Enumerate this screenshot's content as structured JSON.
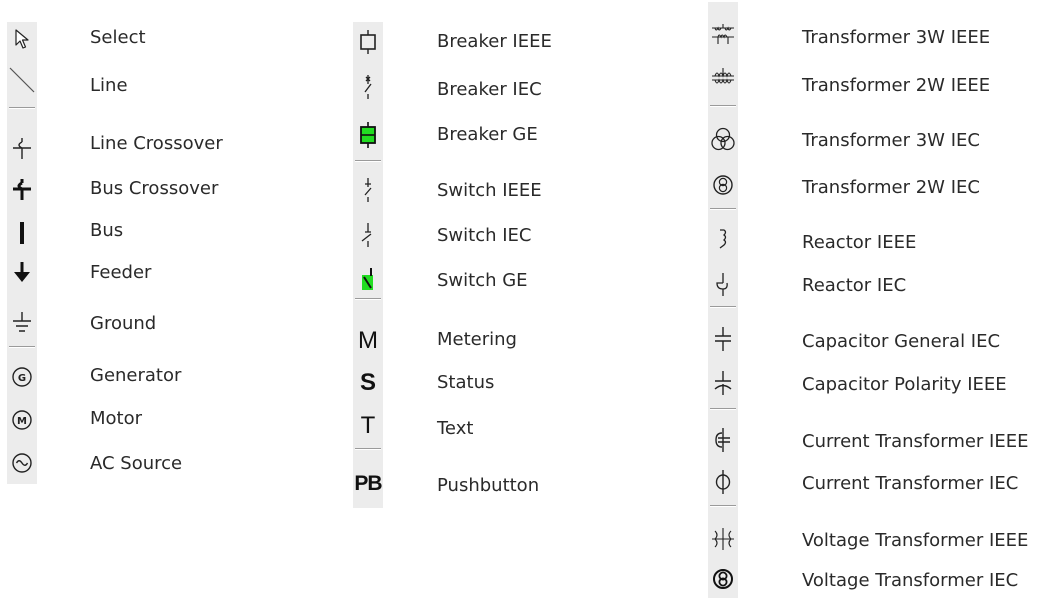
{
  "columns": [
    {
      "tools": [
        {
          "icon": "select-arrow-icon",
          "label": "Select"
        },
        {
          "icon": "line-icon",
          "label": "Line"
        },
        {
          "icon": "line-crossover-icon",
          "label": "Line Crossover"
        },
        {
          "icon": "bus-crossover-icon",
          "label": "Bus Crossover"
        },
        {
          "icon": "bus-icon",
          "label": "Bus"
        },
        {
          "icon": "feeder-icon",
          "label": "Feeder"
        },
        {
          "icon": "ground-icon",
          "label": "Ground"
        },
        {
          "icon": "generator-icon",
          "label": "Generator",
          "glyph": "G"
        },
        {
          "icon": "motor-icon",
          "label": "Motor",
          "glyph": "M"
        },
        {
          "icon": "ac-source-icon",
          "label": "AC Source"
        }
      ]
    },
    {
      "tools": [
        {
          "icon": "breaker-ieee-icon",
          "label": "Breaker IEEE"
        },
        {
          "icon": "breaker-iec-icon",
          "label": "Breaker IEC"
        },
        {
          "icon": "breaker-ge-icon",
          "label": "Breaker GE"
        },
        {
          "icon": "switch-ieee-icon",
          "label": "Switch IEEE"
        },
        {
          "icon": "switch-iec-icon",
          "label": "Switch IEC"
        },
        {
          "icon": "switch-ge-icon",
          "label": "Switch GE"
        },
        {
          "icon": "metering-icon",
          "label": "Metering",
          "glyph": "M"
        },
        {
          "icon": "status-icon",
          "label": "Status",
          "glyph": "S"
        },
        {
          "icon": "text-icon",
          "label": "Text",
          "glyph": "T"
        },
        {
          "icon": "pushbutton-icon",
          "label": "Pushbutton",
          "glyph": "PB"
        }
      ]
    },
    {
      "tools": [
        {
          "icon": "transformer-3w-ieee-icon",
          "label": "Transformer 3W IEEE"
        },
        {
          "icon": "transformer-2w-ieee-icon",
          "label": "Transformer 2W IEEE"
        },
        {
          "icon": "transformer-3w-iec-icon",
          "label": "Transformer 3W IEC"
        },
        {
          "icon": "transformer-2w-iec-icon",
          "label": "Transformer 2W IEC"
        },
        {
          "icon": "reactor-ieee-icon",
          "label": "Reactor IEEE"
        },
        {
          "icon": "reactor-iec-icon",
          "label": "Reactor IEC"
        },
        {
          "icon": "capacitor-general-iec-icon",
          "label": "Capacitor General IEC"
        },
        {
          "icon": "capacitor-polarity-ieee-icon",
          "label": "Capacitor Polarity IEEE"
        },
        {
          "icon": "current-transformer-ieee-icon",
          "label": "Current Transformer IEEE"
        },
        {
          "icon": "current-transformer-iec-icon",
          "label": "Current Transformer IEC"
        },
        {
          "icon": "voltage-transformer-ieee-icon",
          "label": "Voltage Transformer IEEE"
        },
        {
          "icon": "voltage-transformer-iec-icon",
          "label": "Voltage Transformer IEC"
        }
      ]
    }
  ],
  "colors": {
    "toolbar_bg": "#ececec",
    "ge_green": "#22dd22",
    "icon_stroke": "#111111"
  }
}
